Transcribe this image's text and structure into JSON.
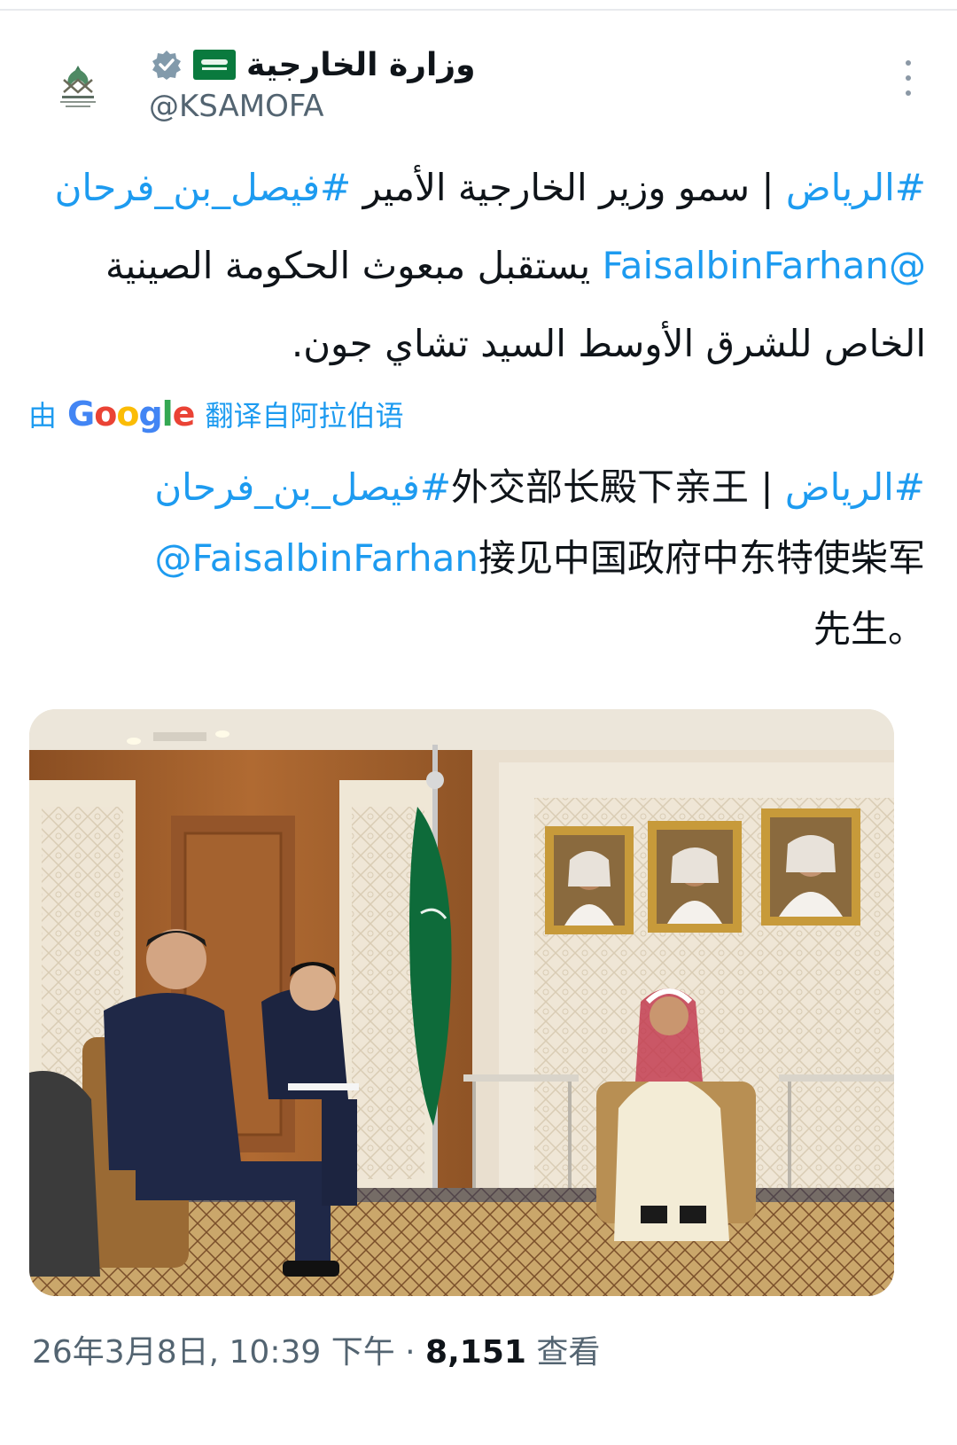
{
  "account": {
    "display_name": "وزارة الخارجية",
    "handle": "@KSAMOFA",
    "avatar_icon": "ministry-emblem-icon",
    "verified_icon": "verified-badge-icon",
    "flag_icon": "saudi-flag-icon"
  },
  "tweet_arabic": {
    "line1": {
      "tag1": "#الرياض",
      "text1": " | سمو وزير الخارجية الأمير ",
      "tag2": "#فيصل_بن_فرحان"
    },
    "line2": {
      "mention": "@FaisalbinFarhan",
      "text": " يستقبل مبعوث الحكومة الصينية"
    },
    "line3": "الخاص للشرق الأوسط السيد تشاي جون."
  },
  "translation": {
    "prefix": "由",
    "provider": "Google",
    "suffix": "翻译自阿拉伯语"
  },
  "tweet_chinese": {
    "line1": {
      "tag1": "#الرياض",
      "sep": " | ",
      "text": "外交部长殿下亲王",
      "tag2": "#فيصل_بن_فرحان"
    },
    "line2": {
      "mention": "@FaisalbinFarhan",
      "text": "接见中国政府中东特使柴军"
    },
    "line3": "先生。"
  },
  "meta": {
    "timestamp": "26年3月8日, 10:39 下午",
    "separator": " · ",
    "views_count": "8,151",
    "views_label": " 查看"
  },
  "colors": {
    "link": "#1d9bf0",
    "secondary": "#536471",
    "flag_green": "#0a7a3e"
  }
}
